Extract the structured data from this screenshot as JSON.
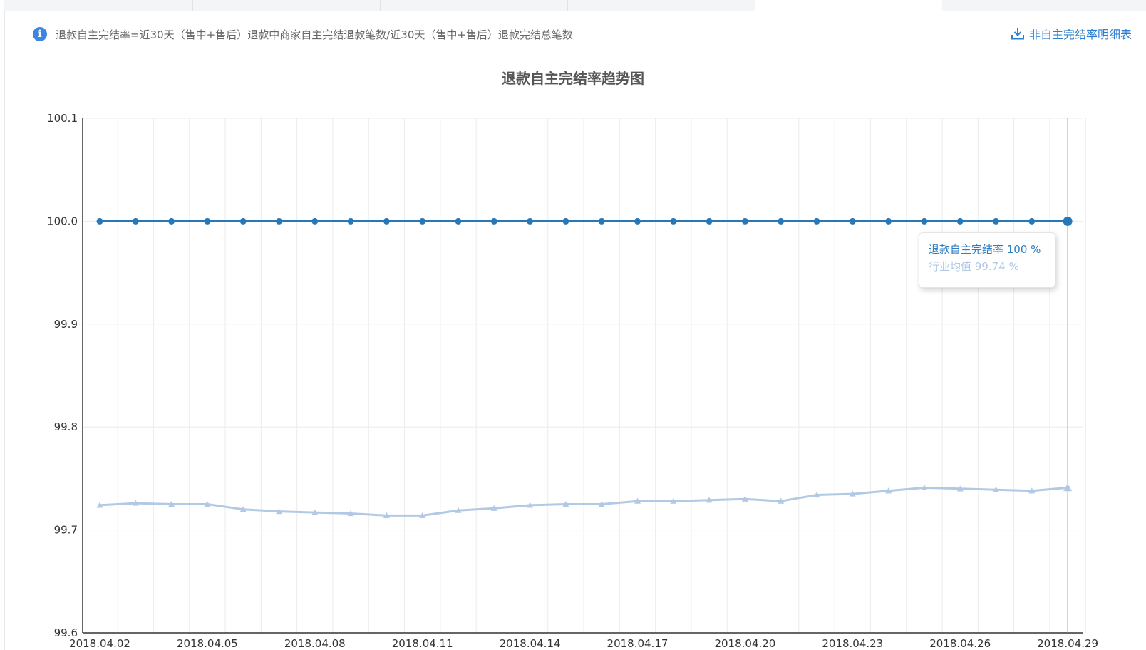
{
  "info": {
    "icon": "info-icon",
    "text": "退款自主完结率=近30天（售中+售后）退款中商家自主完结退款笔数/近30天（售中+售后）退款完结总笔数"
  },
  "download": {
    "icon": "download-icon",
    "label": "非自主完结率明细表"
  },
  "colors": {
    "series_main": "#2878b8",
    "series_industry": "#b2c9e6",
    "axis": "#333333",
    "grid": "#ececec",
    "crosshair": "#999999"
  },
  "tooltip": {
    "row1": "退款自主完结率 100 %",
    "row2": "行业均值 99.74 %"
  },
  "chart_data": {
    "type": "line",
    "title": "退款自主完结率趋势图",
    "x": [
      "2018.04.02",
      "2018.04.03",
      "2018.04.04",
      "2018.04.05",
      "2018.04.06",
      "2018.04.07",
      "2018.04.08",
      "2018.04.09",
      "2018.04.10",
      "2018.04.11",
      "2018.04.12",
      "2018.04.13",
      "2018.04.14",
      "2018.04.15",
      "2018.04.16",
      "2018.04.17",
      "2018.04.18",
      "2018.04.19",
      "2018.04.20",
      "2018.04.21",
      "2018.04.22",
      "2018.04.23",
      "2018.04.24",
      "2018.04.25",
      "2018.04.26",
      "2018.04.27",
      "2018.04.28",
      "2018.04.29"
    ],
    "x_tick_labels": [
      "2018.04.02",
      "2018.04.05",
      "2018.04.08",
      "2018.04.11",
      "2018.04.14",
      "2018.04.17",
      "2018.04.20",
      "2018.04.23",
      "2018.04.26",
      "2018.04.29"
    ],
    "series": [
      {
        "name": "退款自主完结率",
        "marker": "circle",
        "values": [
          100,
          100,
          100,
          100,
          100,
          100,
          100,
          100,
          100,
          100,
          100,
          100,
          100,
          100,
          100,
          100,
          100,
          100,
          100,
          100,
          100,
          100,
          100,
          100,
          100,
          100,
          100,
          100
        ]
      },
      {
        "name": "行业均值",
        "marker": "triangle",
        "values": [
          99.724,
          99.726,
          99.725,
          99.725,
          99.72,
          99.718,
          99.717,
          99.716,
          99.714,
          99.714,
          99.719,
          99.721,
          99.724,
          99.725,
          99.725,
          99.728,
          99.728,
          99.729,
          99.73,
          99.728,
          99.734,
          99.735,
          99.738,
          99.741,
          99.74,
          99.739,
          99.738,
          99.741
        ]
      }
    ],
    "y_ticks": [
      "100.1",
      "100.0",
      "99.9",
      "99.8",
      "99.7",
      "99.6"
    ],
    "ylim": [
      99.6,
      100.1
    ],
    "xlabel": "",
    "ylabel": "",
    "grid": true,
    "legend": "none",
    "highlight_index": 27
  }
}
